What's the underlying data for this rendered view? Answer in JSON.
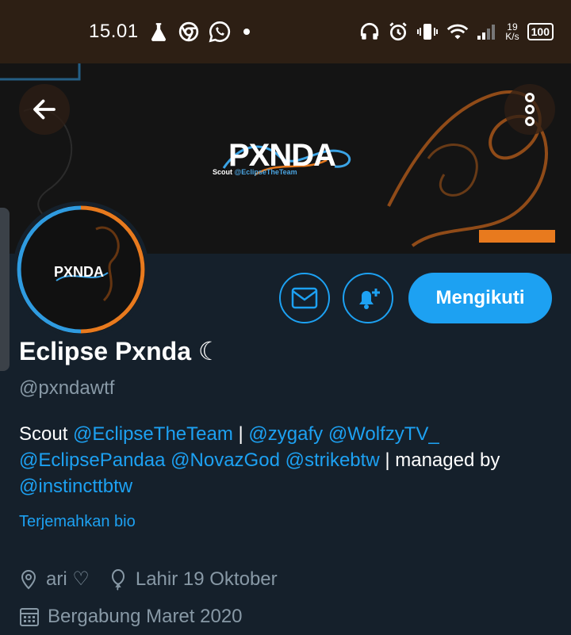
{
  "status_bar": {
    "time": "15.01",
    "speed_value": "19",
    "speed_unit": "K/s",
    "battery": "100",
    "icons": [
      "flask-icon",
      "chrome-icon",
      "whatsapp-icon",
      "dot-icon",
      "headphones-icon",
      "alarm-icon",
      "vibrate-icon",
      "wifi-icon",
      "signal-icon"
    ]
  },
  "banner": {
    "brand": "PXNDA",
    "tag_prefix": "Scout",
    "tag_team": "@EclipseTheTeam",
    "accent_orange": "#e87a1e",
    "accent_blue": "#3ba4e6"
  },
  "avatar": {
    "brand": "PXNDA"
  },
  "profile": {
    "display_name": "Eclipse Pxnda ☾",
    "handle": "@pxndawtf",
    "follow_label": "Mengikuti",
    "bio": {
      "t1": "Scout ",
      "m1": "@EclipseTheTeam",
      "t2": " | ",
      "m2": "@zygafy",
      "t3": " ",
      "m3": "@WolfzyTV_",
      "t4": " ",
      "m4": "@EclipsePandaa",
      "t5": " ",
      "m5": "@NovazGod",
      "t6": " ",
      "m6": "@strikebtw",
      "t7": " | managed by ",
      "m7": "@instincttbtw"
    },
    "translate_label": "Terjemahkan bio",
    "location": "ari ♡",
    "birthday": "Lahir 19 Oktober",
    "joined": "Bergabung Maret 2020"
  },
  "colors": {
    "background": "#15202b",
    "accent": "#1da1f2",
    "muted": "#8899a6",
    "status_bar": "#2d1f14"
  }
}
